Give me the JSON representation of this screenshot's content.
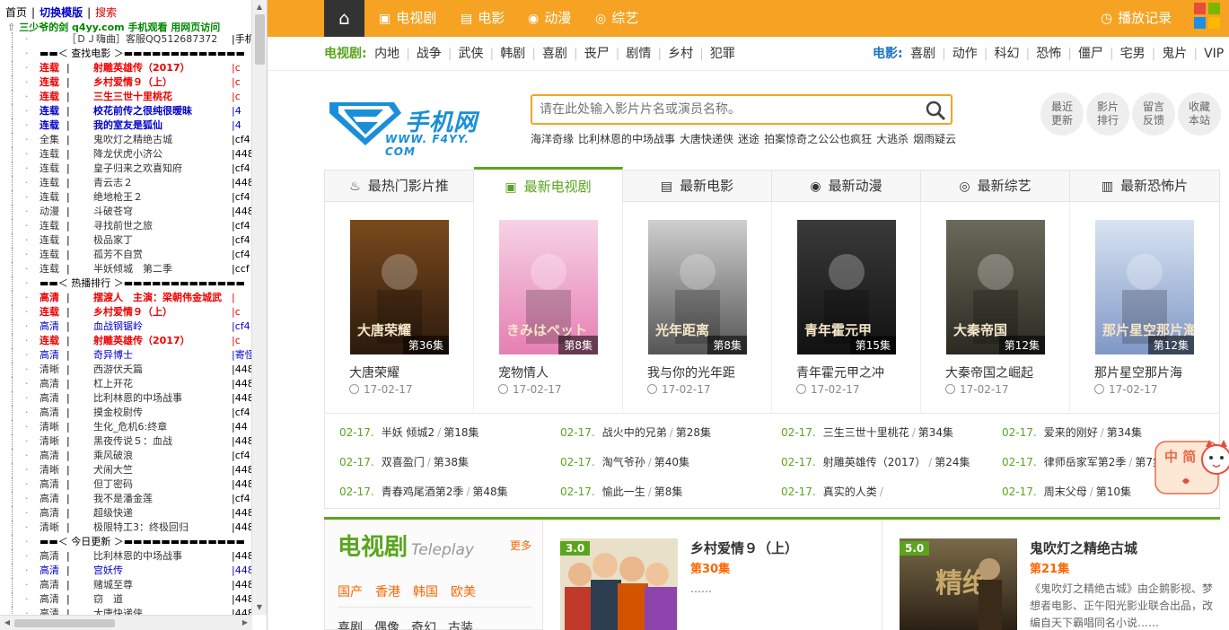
{
  "left_frame": {
    "header": {
      "home": "首页",
      "switch": "切换模版",
      "search": "搜索"
    },
    "subtitle": "三少爷的剑 q4yy.com 手机观看 用网页访问",
    "rows": [
      {
        "type": "top",
        "title": "［ＤＪ嗨曲］客服QQ512687372",
        "code": "手机"
      },
      {
        "type": "hdr",
        "title": "▬▬＜ 查找电影 ＞▬▬▬▬▬▬▬▬▬▬▬▬▬"
      },
      {
        "type": "red",
        "cat": "连载",
        "title": "射雕英雄传（2017）",
        "code": "c"
      },
      {
        "type": "red",
        "cat": "连载",
        "title": "乡村爱情９（上）",
        "code": "c"
      },
      {
        "type": "red",
        "cat": "连载",
        "title": "三生三世十里桃花",
        "code": "c"
      },
      {
        "type": "blue",
        "cat": "连载",
        "title": "校花前传之很纯很暧昧",
        "code": "4"
      },
      {
        "type": "blue",
        "cat": "连载",
        "title": "我的室友是狐仙",
        "code": "4"
      },
      {
        "type": "plain",
        "cat": "全集",
        "title": "鬼吹灯之精绝古城",
        "code": "cf4"
      },
      {
        "type": "plain",
        "cat": "连载",
        "title": "降龙伏虎小济公",
        "code": "448"
      },
      {
        "type": "plain",
        "cat": "连载",
        "title": "皇子归来之欢喜知府",
        "code": "cf4"
      },
      {
        "type": "plain",
        "cat": "连载",
        "title": "青云志２",
        "code": "448"
      },
      {
        "type": "plain",
        "cat": "连载",
        "title": "绝地枪王２",
        "code": "cf4"
      },
      {
        "type": "plain",
        "cat": "动漫",
        "title": "斗破苍穹",
        "code": "448"
      },
      {
        "type": "plain",
        "cat": "连载",
        "title": "寻找前世之旅",
        "code": "cf4"
      },
      {
        "type": "plain",
        "cat": "连载",
        "title": "极品家丁",
        "code": "cf4"
      },
      {
        "type": "plain",
        "cat": "连载",
        "title": "孤芳不自赏",
        "code": "cf4"
      },
      {
        "type": "plain",
        "cat": "连载",
        "title": "半妖倾城　第二季",
        "code": "ccf"
      },
      {
        "type": "hdr",
        "title": "▬▬＜ 热播排行 ＞▬▬▬▬▬▬▬▬▬▬▬▬▬"
      },
      {
        "type": "red",
        "cat": "高清",
        "title": "摆渡人　主演：梁朝伟金城武",
        "code": ""
      },
      {
        "type": "red",
        "cat": "连载",
        "title": "乡村爱情９（上）",
        "code": "c"
      },
      {
        "type": "bluen",
        "cat": "高清",
        "title": "血战钢锯岭",
        "code": "cf4"
      },
      {
        "type": "red",
        "cat": "连载",
        "title": "射雕英雄传（2017）",
        "code": "c"
      },
      {
        "type": "bluen",
        "cat": "高清",
        "title": "奇异博士",
        "code": "寄怪"
      },
      {
        "type": "plain",
        "cat": "清晰",
        "title": "西游伏夭篇",
        "code": "448"
      },
      {
        "type": "plain",
        "cat": "高清",
        "title": "杠上开花",
        "code": "448"
      },
      {
        "type": "plain",
        "cat": "高清",
        "title": "比利林恩的中场战事",
        "code": "448"
      },
      {
        "type": "plain",
        "cat": "高清",
        "title": "摸金校尉传",
        "code": "cf4"
      },
      {
        "type": "plain",
        "cat": "清晰",
        "title": "生化_危机6:终章",
        "code": "44"
      },
      {
        "type": "plain",
        "cat": "清晰",
        "title": "黑夜传说５：血战",
        "code": "448"
      },
      {
        "type": "plain",
        "cat": "高清",
        "title": "乘风破浪",
        "code": "cf4"
      },
      {
        "type": "plain",
        "cat": "清晰",
        "title": "犬闹大竺",
        "code": "448"
      },
      {
        "type": "plain",
        "cat": "高清",
        "title": "但丁密码",
        "code": "448"
      },
      {
        "type": "plain",
        "cat": "高清",
        "title": "我不是潘金莲",
        "code": "cf4"
      },
      {
        "type": "plain",
        "cat": "高清",
        "title": "超级快递",
        "code": "448"
      },
      {
        "type": "plain",
        "cat": "清晰",
        "title": "极限特工3：终极回归",
        "code": "448"
      },
      {
        "type": "hdr",
        "title": "▬▬＜ 今日更新 ＞▬▬▬▬▬▬▬▬▬▬▬▬▬"
      },
      {
        "type": "plain",
        "cat": "高清",
        "title": "比利林恩的中场战事",
        "code": "448"
      },
      {
        "type": "bluen",
        "cat": "高清",
        "title": "宫妖传",
        "code": "448"
      },
      {
        "type": "plain",
        "cat": "高清",
        "title": "赌城至尊",
        "code": "448"
      },
      {
        "type": "plain",
        "cat": "高清",
        "title": "窃　道",
        "code": "448"
      },
      {
        "type": "plain",
        "cat": "高清",
        "title": "大唐快递侠",
        "code": "448"
      }
    ]
  },
  "topnav": {
    "items": [
      {
        "icon": "tv-icon",
        "glyph": "▣",
        "label": "电视剧"
      },
      {
        "icon": "film-icon",
        "glyph": "▤",
        "label": "电影"
      },
      {
        "icon": "anime-icon",
        "glyph": "◉",
        "label": "动漫"
      },
      {
        "icon": "variety-icon",
        "glyph": "◎",
        "label": "综艺"
      }
    ],
    "record": "播放记录",
    "accent": "#f6a323"
  },
  "catrow": {
    "tv_label": "电视剧:",
    "tv_items": [
      "内地",
      "战争",
      "武侠",
      "韩剧",
      "喜剧",
      "丧尸",
      "剧情",
      "乡村",
      "犯罪"
    ],
    "movie_label": "电影:",
    "movie_items": [
      "喜剧",
      "动作",
      "科幻",
      "恐怖",
      "僵尸",
      "宅男",
      "鬼片",
      "VIP"
    ]
  },
  "logo": {
    "text": "手机网",
    "url": "WWW. F4YY. COM"
  },
  "search": {
    "placeholder": "请在此处输入影片片名或演员名称。",
    "hotwords": [
      "海洋奇缘",
      "比利林恩的中场战事",
      "大唐快递侠",
      "迷途",
      "拍案惊奇之公公也疯狂",
      "大逃杀",
      "烟雨疑云"
    ]
  },
  "circle_buttons": [
    {
      "l1": "最近",
      "l2": "更新"
    },
    {
      "l1": "影片",
      "l2": "排行"
    },
    {
      "l1": "留言",
      "l2": "反馈"
    },
    {
      "l1": "收藏",
      "l2": "本站"
    }
  ],
  "tabs": [
    {
      "label": "最热门影片推",
      "icon": "flame-icon",
      "glyph": "♨"
    },
    {
      "label": "最新电视剧",
      "icon": "tv-icon",
      "glyph": "▣"
    },
    {
      "label": "最新电影",
      "icon": "film-icon",
      "glyph": "▤"
    },
    {
      "label": "最新动漫",
      "icon": "anime-icon",
      "glyph": "◉"
    },
    {
      "label": "最新综艺",
      "icon": "variety-icon",
      "glyph": "◎"
    },
    {
      "label": "最新恐怖片",
      "icon": "horror-icon",
      "glyph": "▥"
    }
  ],
  "cards": [
    {
      "name": "大唐荣耀",
      "ep": "第36集",
      "date": "17-02-17",
      "c1": "#7a4a1c",
      "c2": "#2b1a0e",
      "ptext": "大唐荣耀"
    },
    {
      "name": "宠物情人",
      "ep": "第8集",
      "date": "17-02-17",
      "c1": "#f7d2e6",
      "c2": "#e57fb2",
      "ptext": "きみはペット"
    },
    {
      "name": "我与你的光年距",
      "ep": "第8集",
      "date": "17-02-17",
      "c1": "#cfcfcf",
      "c2": "#555555",
      "ptext": "光年距离"
    },
    {
      "name": "青年霍元甲之冲",
      "ep": "第15集",
      "date": "17-02-17",
      "c1": "#3a3a3a",
      "c2": "#111111",
      "ptext": "青年霍元甲"
    },
    {
      "name": "大秦帝国之崛起",
      "ep": "第12集",
      "date": "17-02-17",
      "c1": "#6a6a5a",
      "c2": "#2a2a22",
      "ptext": "大秦帝国"
    },
    {
      "name": "那片星空那片海",
      "ep": "第12集",
      "date": "17-02-17",
      "c1": "#d9e4f2",
      "c2": "#7f97c7",
      "ptext": "那片星空那片海"
    }
  ],
  "updates": [
    [
      {
        "d": "02-17.",
        "n": "半妖 倾城2",
        "e": "第18集"
      },
      {
        "d": "02-17.",
        "n": "战火中的兄弟",
        "e": "第28集"
      },
      {
        "d": "02-17.",
        "n": "三生三世十里桃花",
        "e": "第34集"
      },
      {
        "d": "02-17.",
        "n": "爱来的刚好",
        "e": "第34集"
      }
    ],
    [
      {
        "d": "02-17.",
        "n": "双喜盈门",
        "e": "第38集"
      },
      {
        "d": "02-17.",
        "n": "淘气爷孙",
        "e": "第40集"
      },
      {
        "d": "02-17.",
        "n": "射雕英雄传（2017）",
        "e": "第24集"
      },
      {
        "d": "02-17.",
        "n": "律师岳家军第2季",
        "e": "第7集"
      }
    ],
    [
      {
        "d": "02-17.",
        "n": "青春鸡尾酒第2季",
        "e": "第48集"
      },
      {
        "d": "02-17.",
        "n": "愉此一生",
        "e": "第8集"
      },
      {
        "d": "02-17.",
        "n": "真实的人类",
        "e": ""
      },
      {
        "d": "02-17.",
        "n": "周末父母",
        "e": "第10集"
      }
    ]
  ],
  "float_badge": {
    "text": "中 简"
  },
  "tvbox": {
    "title": "电视剧",
    "title_en": "Teleplay",
    "more": "更多",
    "regions": [
      "国产",
      "香港",
      "韩国",
      "欧美"
    ],
    "genres": [
      "喜剧",
      "偶像",
      "奇幻",
      "古装"
    ]
  },
  "shows": [
    {
      "score": "3.0",
      "title": "乡村爱情９（上）",
      "ep": "第30集",
      "desc": "……"
    },
    {
      "score": "5.0",
      "title": "鬼吹灯之精绝古城",
      "ep": "第21集",
      "desc": "《鬼吹灯之精绝古城》由企鹅影视、梦想者电影、正午阳光影业联合出品，改编自天下霸唱同名小说……"
    }
  ]
}
